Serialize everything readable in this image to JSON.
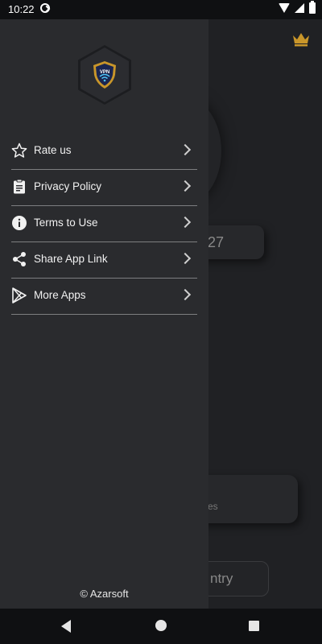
{
  "status_bar": {
    "time": "10:22"
  },
  "background_app": {
    "pill_text": "27",
    "card_text": "es",
    "button_text": "ntry"
  },
  "drawer": {
    "logo_text": "VPN",
    "menu_items": [
      {
        "label": "Rate us",
        "icon": "star-icon"
      },
      {
        "label": "Privacy Policy",
        "icon": "document-icon"
      },
      {
        "label": "Terms to Use",
        "icon": "info-icon"
      },
      {
        "label": "Share App Link",
        "icon": "share-icon"
      },
      {
        "label": "More Apps",
        "icon": "play-store-icon"
      }
    ],
    "copyright": "© Azarsoft"
  },
  "colors": {
    "drawer_bg": "#2a2b2e",
    "accent_gold": "#c9962a",
    "divider": "#7d7e80"
  }
}
